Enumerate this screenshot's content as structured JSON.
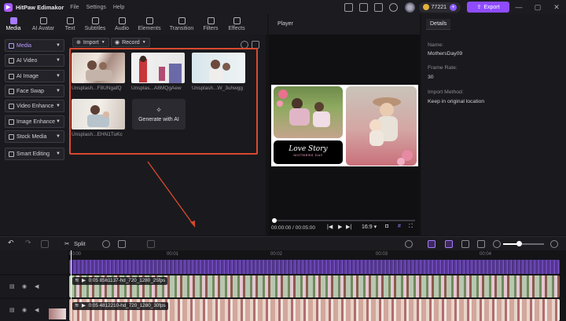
{
  "app": {
    "name": "HitPaw Edimakor",
    "menu": [
      "File",
      "Settings",
      "Help"
    ],
    "coins": "77221",
    "export_label": "Export",
    "window_controls": [
      "—",
      "▢",
      "✕"
    ]
  },
  "toolbar": {
    "tabs": [
      {
        "label": "Media",
        "icon": "media-icon",
        "active": true
      },
      {
        "label": "AI Avatar",
        "icon": "ai-avatar-icon"
      },
      {
        "label": "Text",
        "icon": "text-icon"
      },
      {
        "label": "Subtitles",
        "icon": "subtitles-icon"
      },
      {
        "label": "Audio",
        "icon": "audio-icon"
      },
      {
        "label": "Elements",
        "icon": "elements-icon"
      },
      {
        "label": "Transition",
        "icon": "transition-icon"
      },
      {
        "label": "Filters",
        "icon": "filters-icon"
      },
      {
        "label": "Effects",
        "icon": "effects-icon"
      }
    ]
  },
  "sidebar": {
    "items": [
      {
        "label": "Media",
        "active": true
      },
      {
        "label": "AI Video"
      },
      {
        "label": "AI Image"
      },
      {
        "label": "Face Swap"
      },
      {
        "label": "Video Enhance"
      },
      {
        "label": "Image Enhance"
      },
      {
        "label": "Stock Media"
      },
      {
        "label": "Smart Editing"
      }
    ]
  },
  "media": {
    "import_label": "Import",
    "record_label": "Record",
    "items": [
      {
        "label": "Unsplash...F8UNgafQ"
      },
      {
        "label": "Unsplas...A8MQgAew"
      },
      {
        "label": "Unsplash...W_3uhwgg"
      },
      {
        "label": "Unsplash...EHN1TuKc"
      }
    ],
    "generate_label": "Generate with AI"
  },
  "player": {
    "title": "Player",
    "overlay_title": "Love Story",
    "overlay_subtitle": "MOTHERS DAY",
    "time": "00:00:00 / 00:05:00",
    "aspect": "16:9"
  },
  "details": {
    "tab": "Details",
    "name_label": "Name:",
    "name_value": "MothersDay09",
    "frame_rate_label": "Frame Rate:",
    "frame_rate_value": "30",
    "import_method_label": "Import Method:",
    "import_method_value": "Keep in original location"
  },
  "timeline": {
    "split_label": "Split",
    "ruler": [
      "00:00",
      "00:01",
      "00:02",
      "00:03",
      "00:04"
    ],
    "clip1_label": "0:05  8561137-hd_720_1280_25fps",
    "clip2_label": "0:05  4812210-hd_720_1280_30fps"
  }
}
